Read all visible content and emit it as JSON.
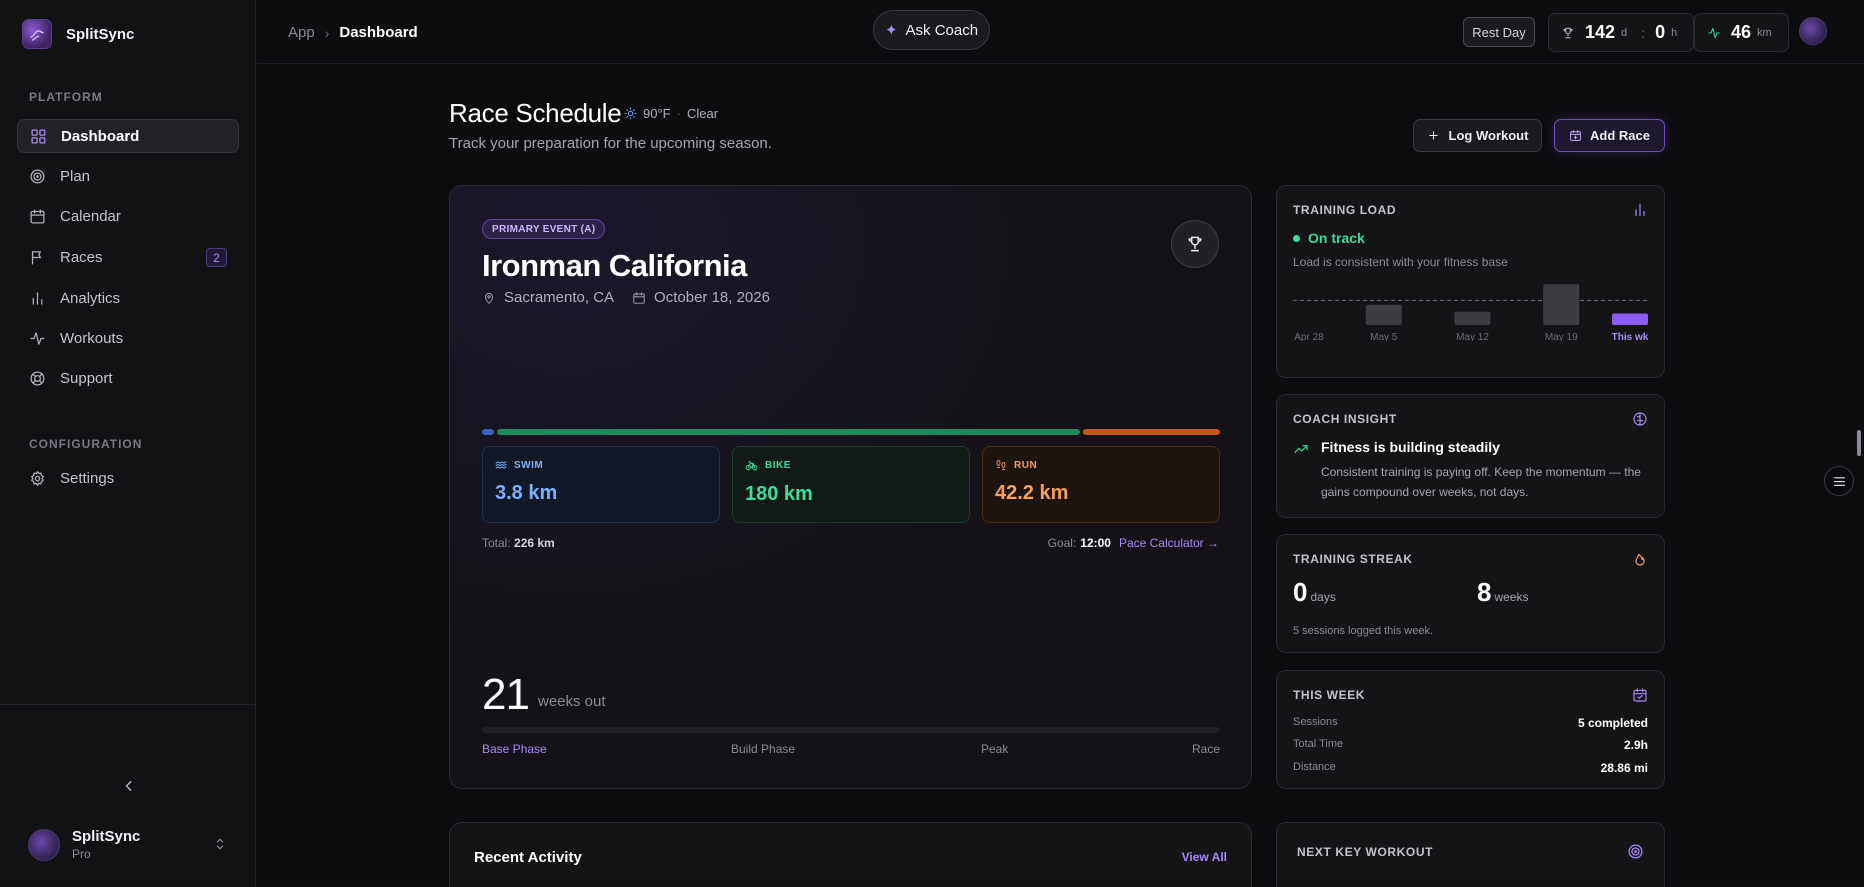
{
  "app": {
    "name": "SplitSync"
  },
  "sidebar": {
    "sections": [
      "PLATFORM",
      "CONFIGURATION"
    ],
    "items": [
      {
        "label": "Dashboard",
        "icon": "dashboard-icon",
        "active": true
      },
      {
        "label": "Plan",
        "icon": "target-icon"
      },
      {
        "label": "Calendar",
        "icon": "calendar-icon"
      },
      {
        "label": "Races",
        "icon": "flag-icon",
        "badge": "2"
      },
      {
        "label": "Analytics",
        "icon": "bar-chart-icon"
      },
      {
        "label": "Workouts",
        "icon": "activity-icon"
      },
      {
        "label": "Support",
        "icon": "lifebuoy-icon"
      }
    ],
    "config_items": [
      {
        "label": "Settings",
        "icon": "gear-icon"
      }
    ],
    "user": {
      "name": "SplitSync",
      "plan": "Pro"
    }
  },
  "topbar": {
    "breadcrumb": [
      "App",
      "Dashboard"
    ],
    "ask_coach": "Ask Coach",
    "rest_day": "Rest Day",
    "countdown": {
      "days": "142",
      "days_unit": "d",
      "hours": "0",
      "hours_unit": "h"
    },
    "distance": {
      "value": "46",
      "unit": "km"
    }
  },
  "header": {
    "title": "Race Schedule",
    "weather": {
      "temp": "90°F",
      "condition": "Clear"
    },
    "subtitle": "Track your preparation for the upcoming season.",
    "log_workout": "Log Workout",
    "add_race": "Add Race"
  },
  "race": {
    "badge": "PRIMARY EVENT (A)",
    "name": "Ironman California",
    "location": "Sacramento, CA",
    "date": "October 18, 2026",
    "segments": [
      {
        "sport": "SWIM",
        "distance": "3.8 km",
        "km": 3.8,
        "color": "#3b63c9"
      },
      {
        "sport": "BIKE",
        "distance": "180 km",
        "km": 180,
        "color": "#1d8a5c"
      },
      {
        "sport": "RUN",
        "distance": "42.2 km",
        "km": 42.2,
        "color": "#c2561a"
      }
    ],
    "total_label": "Total:",
    "total": "226 km",
    "goal_label": "Goal:",
    "goal": "12:00",
    "pace_calculator": "Pace Calculator →",
    "weeks_out": "21",
    "weeks_label": "weeks out",
    "phases": [
      "Base Phase",
      "Build Phase",
      "Peak",
      "Race"
    ],
    "active_phase": "Base Phase"
  },
  "training_load": {
    "title": "TRAINING LOAD",
    "status": "On track",
    "description": "Load is consistent with your fitness base",
    "chart_data": {
      "type": "bar",
      "categories": [
        "Apr 28",
        "May 5",
        "May 12",
        "May 19",
        "This wk"
      ],
      "values": [
        0,
        0.46,
        0.3,
        0.93,
        0.26
      ],
      "highlight": "This wk",
      "reference_line": 0.56
    }
  },
  "coach_insight": {
    "title": "COACH INSIGHT",
    "headline": "Fitness is building steadily",
    "text": "Consistent training is paying off. Keep the momentum — the gains compound over weeks, not days."
  },
  "streak": {
    "title": "TRAINING STREAK",
    "days": "0",
    "days_unit": "days",
    "weeks": "8",
    "weeks_unit": "weeks",
    "note": "5 sessions logged this week."
  },
  "this_week": {
    "title": "THIS WEEK",
    "rows": [
      {
        "label": "Sessions",
        "value": "5 completed"
      },
      {
        "label": "Total Time",
        "value": "2.9h"
      },
      {
        "label": "Distance",
        "value": "28.86 mi"
      }
    ]
  },
  "recent": {
    "title": "Recent Activity",
    "view_all": "View All"
  },
  "next_workout": {
    "title": "NEXT KEY WORKOUT"
  },
  "colors": {
    "accent": "#a78bfa",
    "success": "#3ddc97",
    "swim": "#7ab0ff",
    "bike": "#3ddc97",
    "run": "#f6a05a"
  }
}
